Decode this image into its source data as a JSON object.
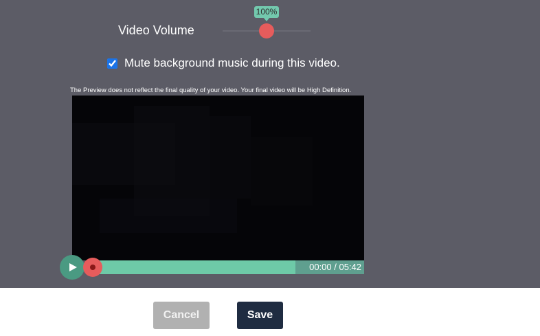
{
  "volume": {
    "label": "Video Volume",
    "value_label": "100%",
    "value_percent": 100
  },
  "mute": {
    "label": "Mute background music during this video.",
    "checked": true
  },
  "preview_note": "The Preview does not reflect the final quality of your video. Your final video will be High Definition.",
  "player": {
    "time": "00:00 / 05:42",
    "progress_percent": 0,
    "play_icon": "play-icon"
  },
  "buttons": {
    "cancel": "Cancel",
    "save": "Save"
  },
  "colors": {
    "dialog_bg": "#5c5c66",
    "accent_green": "#6ecaa8",
    "thumb_red": "#e65c5c",
    "save_bg": "#1f2c41",
    "cancel_bg": "#b1b1b1"
  }
}
